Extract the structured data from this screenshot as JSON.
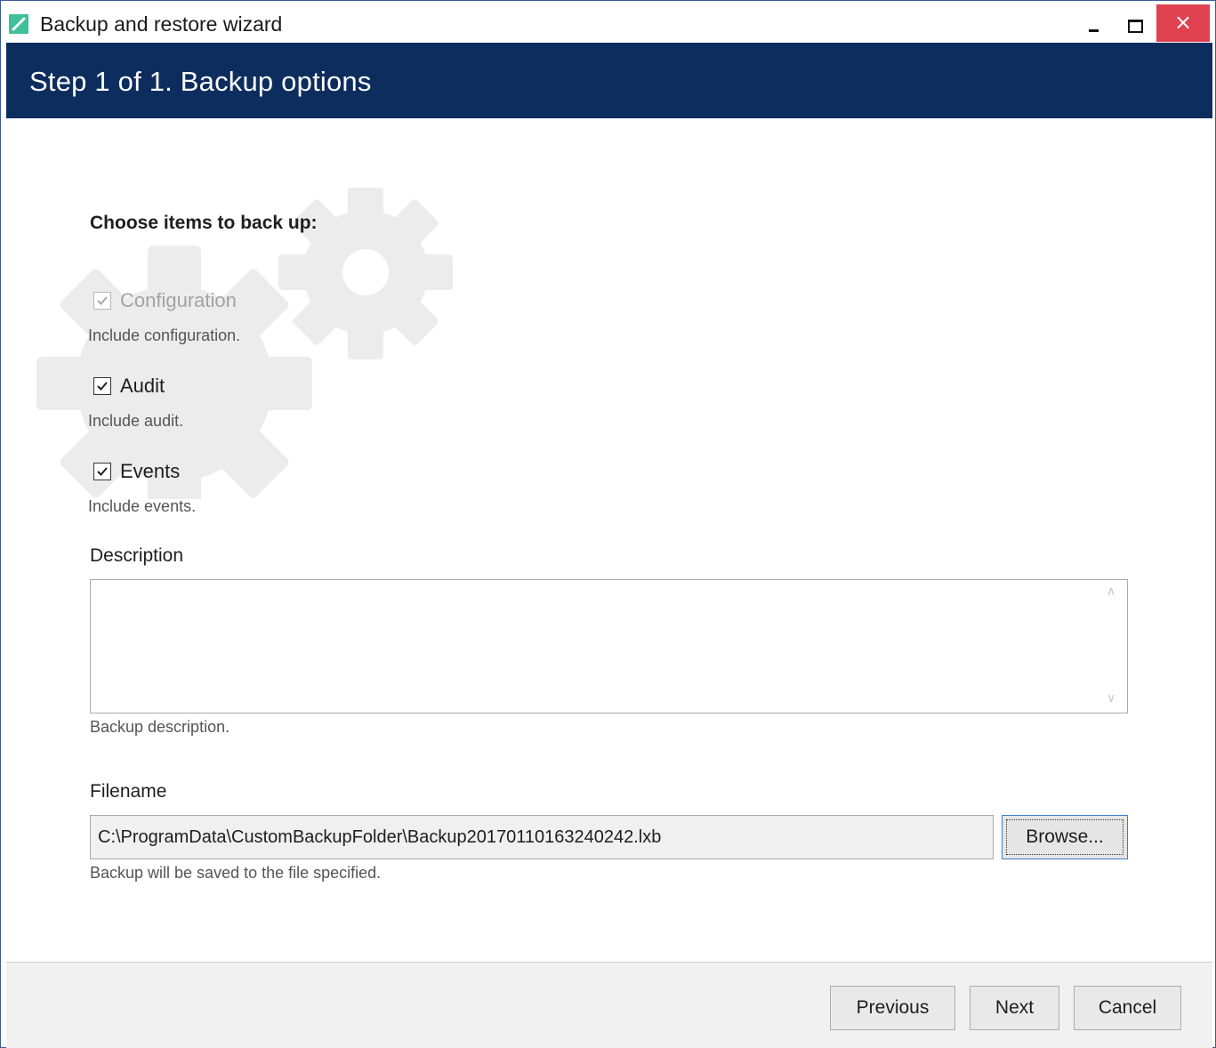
{
  "window": {
    "title": "Backup and restore wizard",
    "close_glyph": "×"
  },
  "header": {
    "title": "Step 1 of 1. Backup options"
  },
  "backup_items": {
    "title": "Choose items to back up:",
    "items": [
      {
        "label": "Configuration",
        "hint": "Include configuration.",
        "checked": true,
        "enabled": false
      },
      {
        "label": "Audit",
        "hint": "Include audit.",
        "checked": true,
        "enabled": true
      },
      {
        "label": "Events",
        "hint": "Include events.",
        "checked": true,
        "enabled": true
      }
    ]
  },
  "description": {
    "label": "Description",
    "value": "",
    "hint": "Backup description."
  },
  "filename": {
    "label": "Filename",
    "value": "C:\\ProgramData\\CustomBackupFolder\\Backup20170110163240242.lxb",
    "hint": "Backup will be saved to the file specified.",
    "browse_label": "Browse..."
  },
  "footer": {
    "previous_label": "Previous",
    "next_label": "Next",
    "cancel_label": "Cancel"
  },
  "colors": {
    "header_bg": "#0d2d5e",
    "close_bg": "#e0414f",
    "app_icon": "#3fbf9a",
    "focus_border": "#3c7fd0"
  },
  "icons": [
    "app-icon",
    "minimize-icon",
    "maximize-icon",
    "close-icon",
    "gear-watermark-icon",
    "checkmark-icon",
    "scroll-up-icon",
    "scroll-down-icon"
  ]
}
